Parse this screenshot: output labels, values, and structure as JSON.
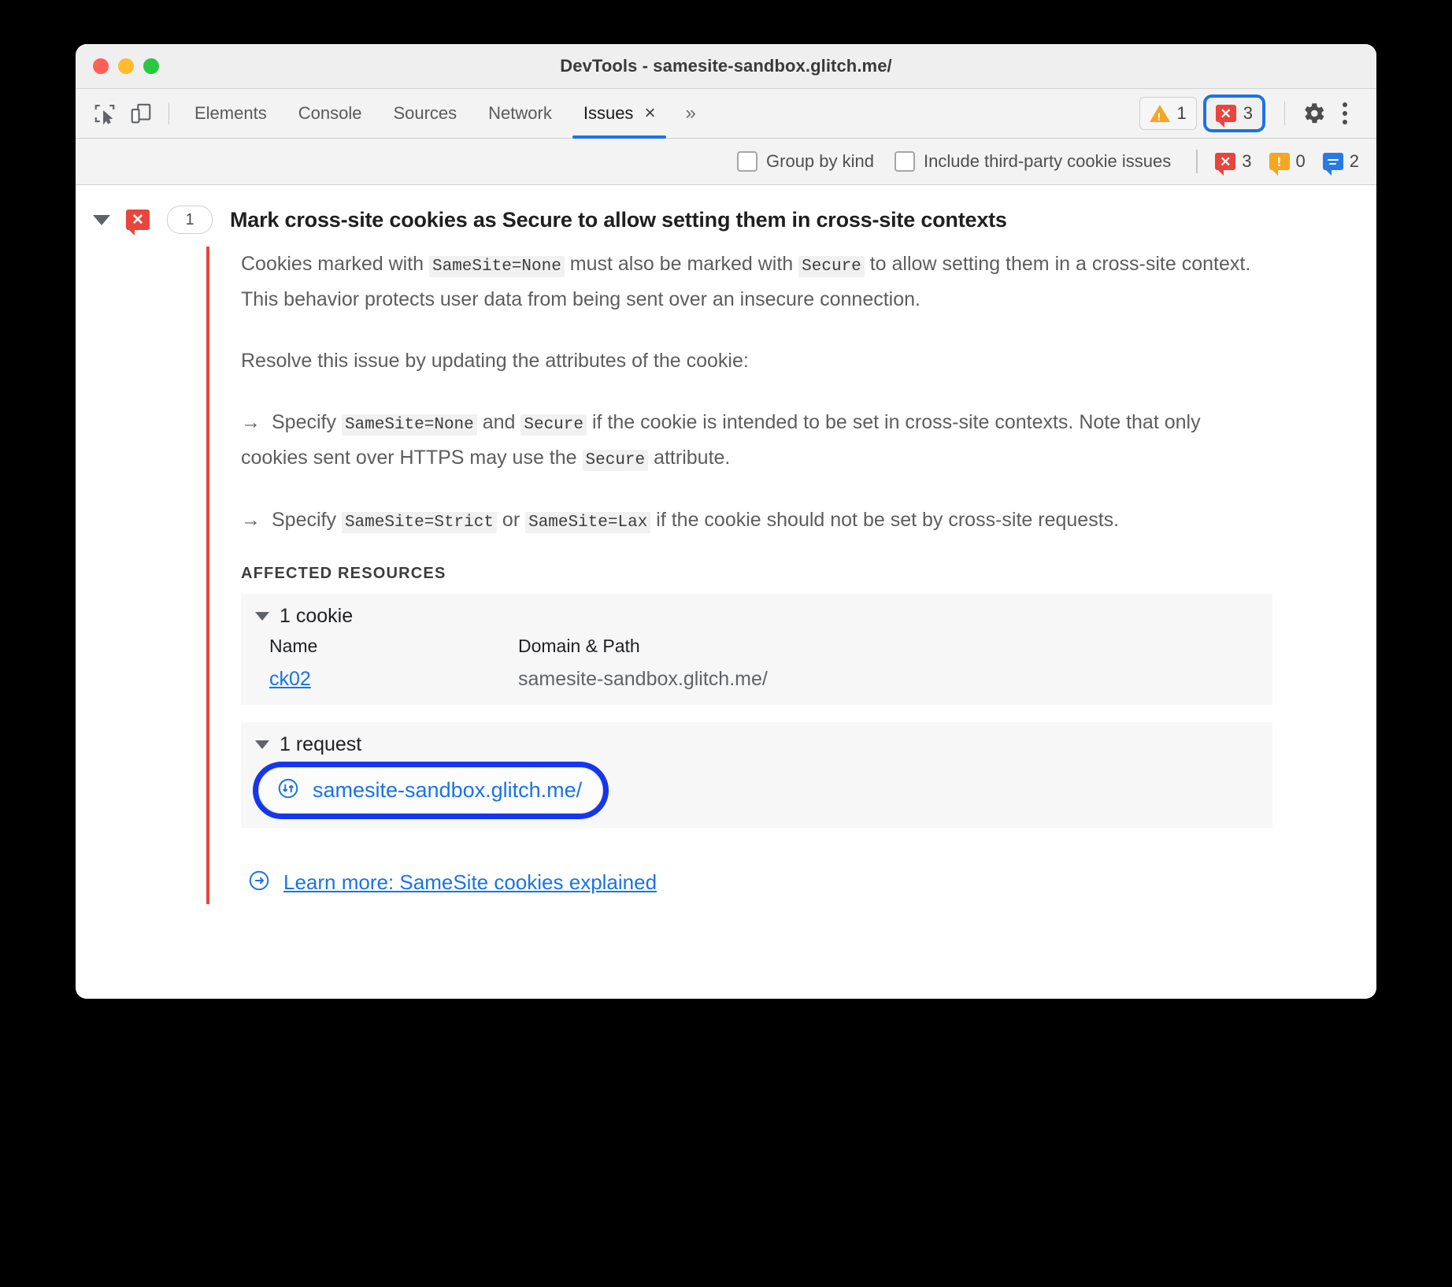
{
  "window": {
    "title": "DevTools - samesite-sandbox.glitch.me/",
    "traffic_lights": [
      "close",
      "minimize",
      "zoom"
    ]
  },
  "toolbar": {
    "inspect_icon": "inspect-element-icon",
    "device_icon": "device-toolbar-icon",
    "tabs": [
      {
        "label": "Elements",
        "active": false
      },
      {
        "label": "Console",
        "active": false
      },
      {
        "label": "Sources",
        "active": false
      },
      {
        "label": "Network",
        "active": false
      },
      {
        "label": "Issues",
        "active": true,
        "closeable": true
      }
    ],
    "tab_close": "×",
    "more_tabs": "»",
    "warning_badge": {
      "icon": "warning-triangle-icon",
      "count": "1"
    },
    "error_badge": {
      "icon": "error-bubble-icon",
      "count": "3",
      "focused": true
    },
    "settings_icon": "gear-icon",
    "menu_icon": "kebab-menu-icon"
  },
  "filterbar": {
    "group_by_kind": {
      "label": "Group by kind",
      "checked": false
    },
    "include_third_party": {
      "label": "Include third-party cookie issues",
      "checked": false
    },
    "counts": [
      {
        "kind": "error",
        "icon": "error-bubble-icon",
        "value": "3",
        "color": "#e8453c"
      },
      {
        "kind": "warning",
        "icon": "warning-bubble-icon",
        "value": "0",
        "color": "#f5a623"
      },
      {
        "kind": "info",
        "icon": "info-bubble-icon",
        "value": "2",
        "color": "#2a7ae4"
      }
    ]
  },
  "issue": {
    "expanded": true,
    "kind_icon": "error-bubble-icon",
    "count": "1",
    "title": "Mark cross-site cookies as Secure to allow setting them in cross-site contexts",
    "paragraphs": [
      {
        "parts": [
          {
            "t": "text",
            "v": "Cookies marked with "
          },
          {
            "t": "code",
            "v": "SameSite=None"
          },
          {
            "t": "text",
            "v": " must also be marked with "
          },
          {
            "t": "code",
            "v": "Secure"
          },
          {
            "t": "text",
            "v": " to allow setting them in a cross-site context. This behavior protects user data from being sent over an insecure connection."
          }
        ]
      },
      {
        "parts": [
          {
            "t": "text",
            "v": "Resolve this issue by updating the attributes of the cookie:"
          }
        ]
      },
      {
        "bullet": "→",
        "parts": [
          {
            "t": "text",
            "v": "Specify "
          },
          {
            "t": "code",
            "v": "SameSite=None"
          },
          {
            "t": "text",
            "v": " and "
          },
          {
            "t": "code",
            "v": "Secure"
          },
          {
            "t": "text",
            "v": " if the cookie is intended to be set in cross-site contexts. Note that only cookies sent over HTTPS may use the "
          },
          {
            "t": "code",
            "v": "Secure"
          },
          {
            "t": "text",
            "v": " attribute."
          }
        ]
      },
      {
        "bullet": "→",
        "parts": [
          {
            "t": "text",
            "v": "Specify "
          },
          {
            "t": "code",
            "v": "SameSite=Strict"
          },
          {
            "t": "text",
            "v": " or "
          },
          {
            "t": "code",
            "v": "SameSite=Lax"
          },
          {
            "t": "text",
            "v": " if the cookie should not be set by cross-site requests."
          }
        ]
      }
    ],
    "affected_resources_label": "AFFECTED RESOURCES",
    "cookie_section": {
      "header": "1 cookie",
      "expanded": true,
      "columns": [
        "Name",
        "Domain & Path"
      ],
      "rows": [
        {
          "name": "ck02",
          "domain_path": "samesite-sandbox.glitch.me/"
        }
      ]
    },
    "request_section": {
      "header": "1 request",
      "expanded": true,
      "icon": "network-request-icon",
      "highlighted": true,
      "rows": [
        {
          "url": "samesite-sandbox.glitch.me/"
        }
      ]
    },
    "learn_more": {
      "icon": "arrow-right-circle-icon",
      "label": "Learn more: SameSite cookies explained"
    }
  },
  "colors": {
    "error": "#e8453c",
    "warning": "#f5a623",
    "info": "#2a7ae4",
    "link": "#1a73e8",
    "focus_ring": "#1536ec",
    "accent_tab": "#1a73e8"
  }
}
